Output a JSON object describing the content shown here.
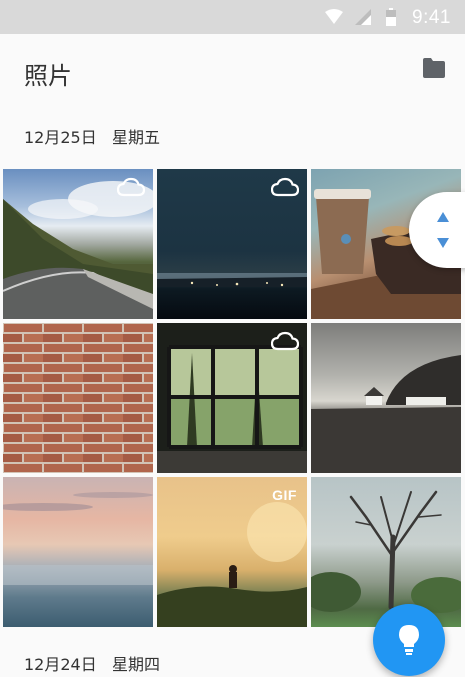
{
  "status_bar": {
    "time": "9:41",
    "icons": [
      "wifi-icon",
      "signal-icon",
      "battery-icon"
    ]
  },
  "header": {
    "title": "照片",
    "folder_icon": "folder-icon"
  },
  "sections": [
    {
      "date": "12月25日",
      "weekday": "星期五"
    },
    {
      "date": "12月24日",
      "weekday": "星期四"
    }
  ],
  "photos": [
    {
      "subject": "mountain-road",
      "badge": "cloud"
    },
    {
      "subject": "night-lake",
      "badge": "cloud"
    },
    {
      "subject": "coffee-cookies",
      "badge": ""
    },
    {
      "subject": "brick-wall",
      "badge": ""
    },
    {
      "subject": "window-trees",
      "badge": "cloud"
    },
    {
      "subject": "coast-houses",
      "badge": ""
    },
    {
      "subject": "sunset-sea",
      "badge": ""
    },
    {
      "subject": "field-figure",
      "badge": "GIF"
    },
    {
      "subject": "bare-tree",
      "badge": ""
    }
  ],
  "colors": {
    "accent": "#2196f3",
    "status_bar": "#d9d9d9",
    "background": "#fafafa",
    "scroll_arrow": "#4a8fd6"
  },
  "fab": {
    "icon": "lightbulb-icon"
  }
}
